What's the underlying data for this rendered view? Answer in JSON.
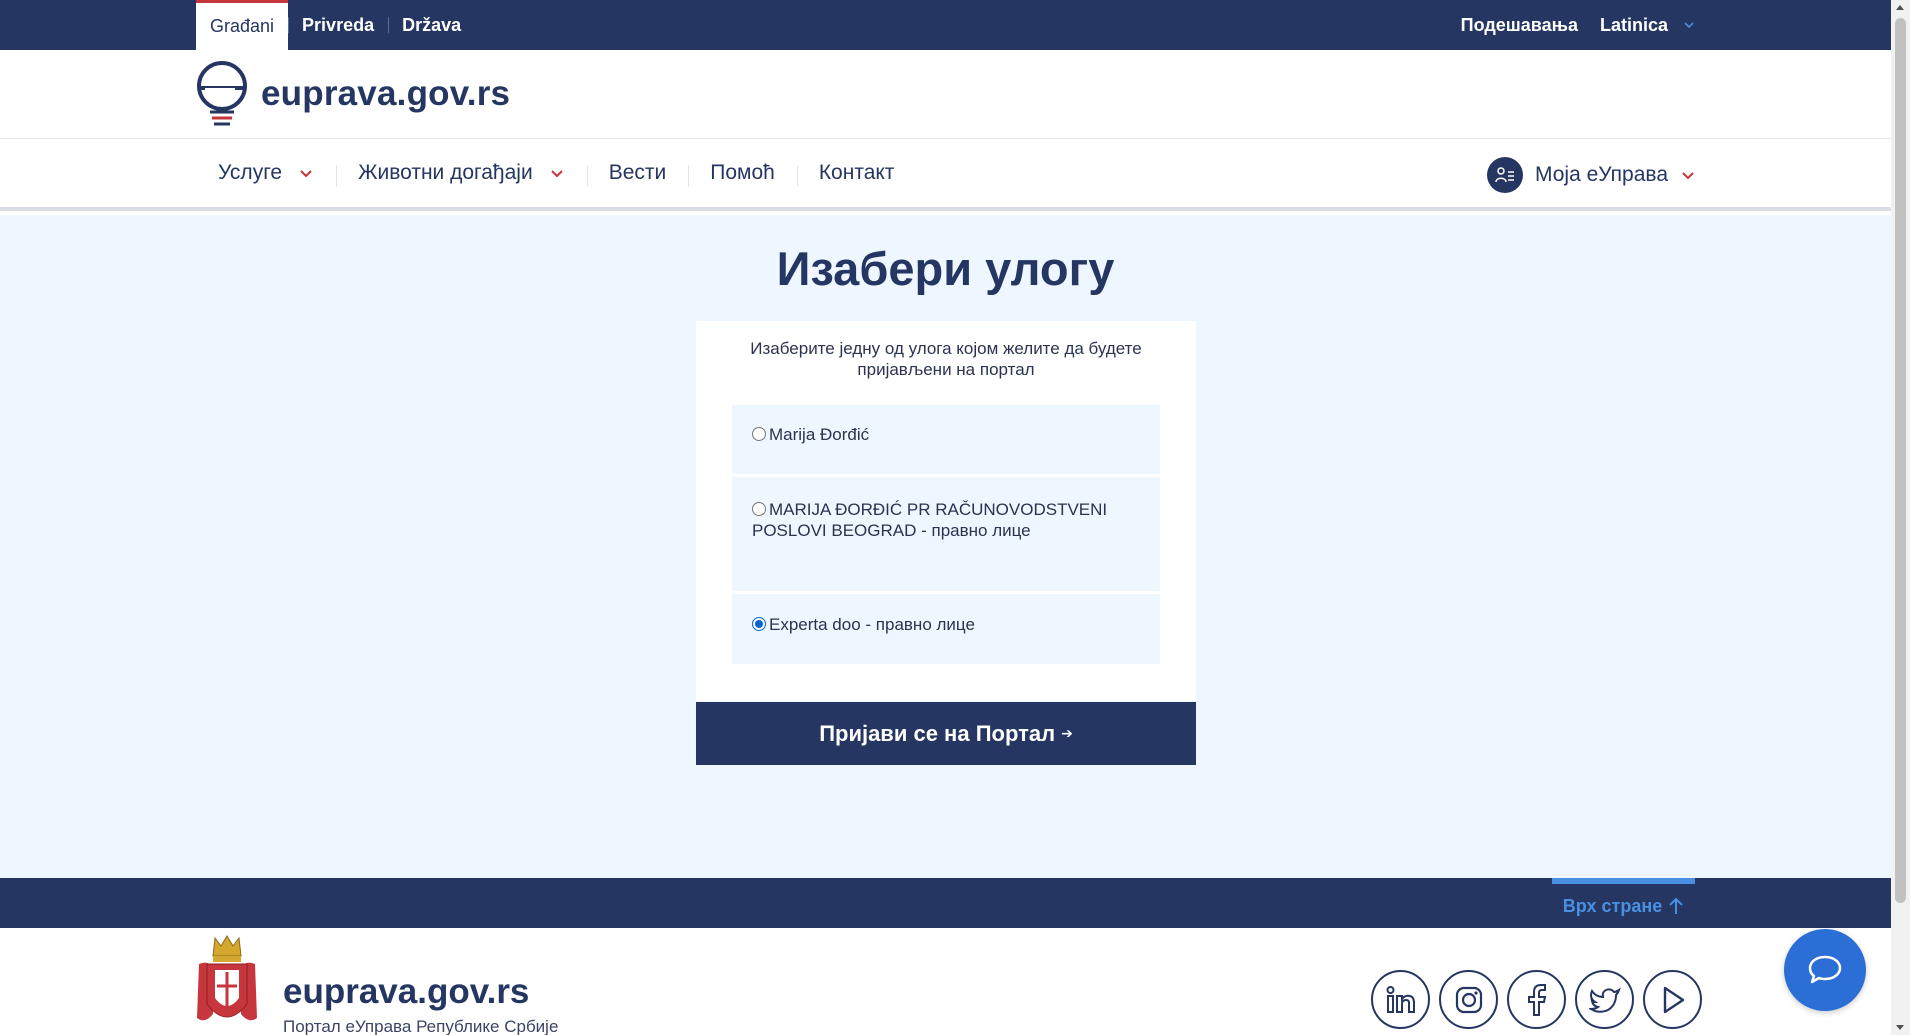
{
  "topbar": {
    "tabs": [
      {
        "label": "Građani",
        "active": true
      },
      {
        "label": "Privreda",
        "active": false
      },
      {
        "label": "Država",
        "active": false
      }
    ],
    "settings_label": "Подешавања",
    "language_label": "Latinica"
  },
  "header": {
    "logo_text": "euprava.gov.rs"
  },
  "nav": {
    "items": [
      {
        "label": "Услуге",
        "has_dropdown": true
      },
      {
        "label": "Животни догађаји",
        "has_dropdown": true
      },
      {
        "label": "Вести",
        "has_dropdown": false
      },
      {
        "label": "Помоћ",
        "has_dropdown": false
      },
      {
        "label": "Контакт",
        "has_dropdown": false
      }
    ],
    "account_label": "Моја еУправа"
  },
  "main": {
    "title": "Изабери улогу",
    "intro": "Изаберите једну од улога којом желите да будете пријављени на портал",
    "roles": [
      {
        "label": "Marija Đorđić",
        "selected": false
      },
      {
        "label": "MARIJA ĐORĐIĆ PR RAČUNOVODSTVENI POSLOVI BEOGRAD - правно лице",
        "selected": false
      },
      {
        "label": "Experta doo - правно лице",
        "selected": true
      }
    ],
    "submit_label": "Пријави се на Портал",
    "submit_arrow": "➔"
  },
  "footer": {
    "back_to_top_label": "Врх стране",
    "brand": "euprava.gov.rs",
    "subtitle": "Портал еУправа Републике Србије",
    "socials": [
      "linkedin-icon",
      "instagram-icon",
      "facebook-icon",
      "twitter-icon",
      "youtube-icon"
    ]
  },
  "colors": {
    "navy": "#243661",
    "accent_red": "#c6363c",
    "light_bg": "#eef6ff",
    "link_blue": "#4a90e2",
    "chat_blue": "#2b6fd6"
  }
}
